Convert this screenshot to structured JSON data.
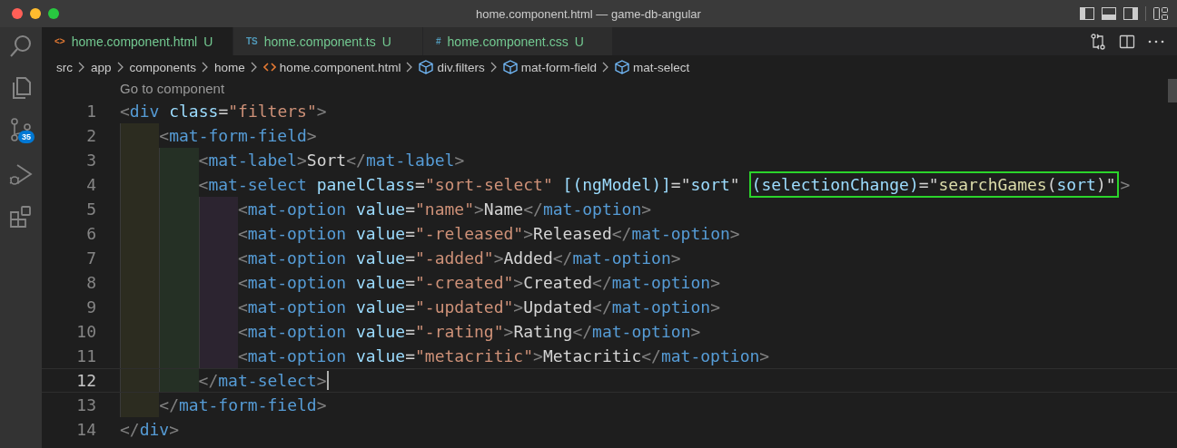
{
  "window": {
    "title": "home.component.html — game-db-angular"
  },
  "activity_bar": [
    {
      "kind": "search",
      "selected": false
    },
    {
      "kind": "files",
      "selected": false
    },
    {
      "kind": "source-control",
      "selected": false,
      "badge": "35"
    },
    {
      "kind": "debug",
      "selected": false
    },
    {
      "kind": "extensions",
      "selected": false
    }
  ],
  "tabs": [
    {
      "icon": "<>",
      "label": "home.component.html",
      "kind": "html",
      "status": "U",
      "selected": true
    },
    {
      "icon": "TS",
      "label": "home.component.ts",
      "kind": "ts",
      "status": "U",
      "selected": false
    },
    {
      "icon": "#",
      "label": "home.component.css",
      "kind": "css",
      "status": "U",
      "selected": false
    }
  ],
  "breadcrumbs": [
    {
      "label": "src",
      "kind": "folder"
    },
    {
      "label": "app",
      "kind": "folder"
    },
    {
      "label": "components",
      "kind": "folder"
    },
    {
      "label": "home",
      "kind": "folder"
    },
    {
      "label": "home.component.html",
      "kind": "html"
    },
    {
      "label": "div.filters",
      "kind": "element"
    },
    {
      "label": "mat-form-field",
      "kind": "element"
    },
    {
      "label": "mat-select",
      "kind": "element"
    }
  ],
  "code_lens": "Go to component",
  "lines": [
    {
      "number": "1",
      "current": false,
      "tokens": [
        {
          "text": "<",
          "kind": "p"
        },
        {
          "text": "div",
          "kind": "tag"
        },
        {
          "text": " class",
          "kind": "attr"
        },
        {
          "text": "=",
          "kind": "plain"
        },
        {
          "text": "\"filters\"",
          "kind": "str"
        },
        {
          "text": ">",
          "kind": "p"
        }
      ],
      "children": [
        {
          "number": "2",
          "current": false,
          "tokens": [
            {
              "text": "<",
              "kind": "p"
            },
            {
              "text": "mat-form-field",
              "kind": "tag"
            },
            {
              "text": ">",
              "kind": "p"
            }
          ],
          "children": [
            {
              "number": "3",
              "current": false,
              "tokens": [
                {
                  "text": "<",
                  "kind": "p"
                },
                {
                  "text": "mat-label",
                  "kind": "tag"
                },
                {
                  "text": ">",
                  "kind": "p"
                },
                {
                  "text": "Sort",
                  "kind": "plain"
                },
                {
                  "text": "</",
                  "kind": "p"
                },
                {
                  "text": "mat-label",
                  "kind": "tag"
                },
                {
                  "text": ">",
                  "kind": "p"
                }
              ]
            },
            {
              "number": "4",
              "current": false,
              "tokens": [
                {
                  "text": "<",
                  "kind": "p"
                },
                {
                  "text": "mat-select",
                  "kind": "tag"
                },
                {
                  "text": " panelClass",
                  "kind": "attr"
                },
                {
                  "text": "=",
                  "kind": "plain"
                },
                {
                  "text": "\"sort-select\"",
                  "kind": "str"
                },
                {
                  "text": " [(ngModel)]",
                  "kind": "attr"
                },
                {
                  "text": "=",
                  "kind": "plain"
                },
                {
                  "text": "\"",
                  "kind": "plain"
                },
                {
                  "text": "sort",
                  "kind": "attr"
                },
                {
                  "text": "\" ",
                  "kind": "plain"
                }
              ],
              "highlight_tokens": [
                {
                  "text": "(selectionChange)",
                  "kind": "attr"
                },
                {
                  "text": "=",
                  "kind": "plain"
                },
                {
                  "text": "\"",
                  "kind": "plain"
                },
                {
                  "text": "searchGames",
                  "kind": "fn"
                },
                {
                  "text": "(",
                  "kind": "plain"
                },
                {
                  "text": "sort",
                  "kind": "attr"
                },
                {
                  "text": ")\"",
                  "kind": "plain"
                }
              ],
              "tail_tokens": [
                {
                  "text": ">",
                  "kind": "p"
                }
              ],
              "children": [
                {
                  "number": "5",
                  "current": false,
                  "tokens": [
                    {
                      "text": "<",
                      "kind": "p"
                    },
                    {
                      "text": "mat-option",
                      "kind": "tag"
                    },
                    {
                      "text": " value",
                      "kind": "attr"
                    },
                    {
                      "text": "=",
                      "kind": "plain"
                    },
                    {
                      "text": "\"name\"",
                      "kind": "str"
                    },
                    {
                      "text": ">",
                      "kind": "p"
                    },
                    {
                      "text": "Name",
                      "kind": "plain"
                    },
                    {
                      "text": "</",
                      "kind": "p"
                    },
                    {
                      "text": "mat-option",
                      "kind": "tag"
                    },
                    {
                      "text": ">",
                      "kind": "p"
                    }
                  ]
                },
                {
                  "number": "6",
                  "current": false,
                  "tokens": [
                    {
                      "text": "<",
                      "kind": "p"
                    },
                    {
                      "text": "mat-option",
                      "kind": "tag"
                    },
                    {
                      "text": " value",
                      "kind": "attr"
                    },
                    {
                      "text": "=",
                      "kind": "plain"
                    },
                    {
                      "text": "\"-released\"",
                      "kind": "str"
                    },
                    {
                      "text": ">",
                      "kind": "p"
                    },
                    {
                      "text": "Released",
                      "kind": "plain"
                    },
                    {
                      "text": "</",
                      "kind": "p"
                    },
                    {
                      "text": "mat-option",
                      "kind": "tag"
                    },
                    {
                      "text": ">",
                      "kind": "p"
                    }
                  ]
                },
                {
                  "number": "7",
                  "current": false,
                  "tokens": [
                    {
                      "text": "<",
                      "kind": "p"
                    },
                    {
                      "text": "mat-option",
                      "kind": "tag"
                    },
                    {
                      "text": " value",
                      "kind": "attr"
                    },
                    {
                      "text": "=",
                      "kind": "plain"
                    },
                    {
                      "text": "\"-added\"",
                      "kind": "str"
                    },
                    {
                      "text": ">",
                      "kind": "p"
                    },
                    {
                      "text": "Added",
                      "kind": "plain"
                    },
                    {
                      "text": "</",
                      "kind": "p"
                    },
                    {
                      "text": "mat-option",
                      "kind": "tag"
                    },
                    {
                      "text": ">",
                      "kind": "p"
                    }
                  ]
                },
                {
                  "number": "8",
                  "current": false,
                  "tokens": [
                    {
                      "text": "<",
                      "kind": "p"
                    },
                    {
                      "text": "mat-option",
                      "kind": "tag"
                    },
                    {
                      "text": " value",
                      "kind": "attr"
                    },
                    {
                      "text": "=",
                      "kind": "plain"
                    },
                    {
                      "text": "\"-created\"",
                      "kind": "str"
                    },
                    {
                      "text": ">",
                      "kind": "p"
                    },
                    {
                      "text": "Created",
                      "kind": "plain"
                    },
                    {
                      "text": "</",
                      "kind": "p"
                    },
                    {
                      "text": "mat-option",
                      "kind": "tag"
                    },
                    {
                      "text": ">",
                      "kind": "p"
                    }
                  ]
                },
                {
                  "number": "9",
                  "current": false,
                  "tokens": [
                    {
                      "text": "<",
                      "kind": "p"
                    },
                    {
                      "text": "mat-option",
                      "kind": "tag"
                    },
                    {
                      "text": " value",
                      "kind": "attr"
                    },
                    {
                      "text": "=",
                      "kind": "plain"
                    },
                    {
                      "text": "\"-updated\"",
                      "kind": "str"
                    },
                    {
                      "text": ">",
                      "kind": "p"
                    },
                    {
                      "text": "Updated",
                      "kind": "plain"
                    },
                    {
                      "text": "</",
                      "kind": "p"
                    },
                    {
                      "text": "mat-option",
                      "kind": "tag"
                    },
                    {
                      "text": ">",
                      "kind": "p"
                    }
                  ]
                },
                {
                  "number": "10",
                  "current": false,
                  "tokens": [
                    {
                      "text": "<",
                      "kind": "p"
                    },
                    {
                      "text": "mat-option",
                      "kind": "tag"
                    },
                    {
                      "text": " value",
                      "kind": "attr"
                    },
                    {
                      "text": "=",
                      "kind": "plain"
                    },
                    {
                      "text": "\"-rating\"",
                      "kind": "str"
                    },
                    {
                      "text": ">",
                      "kind": "p"
                    },
                    {
                      "text": "Rating",
                      "kind": "plain"
                    },
                    {
                      "text": "</",
                      "kind": "p"
                    },
                    {
                      "text": "mat-option",
                      "kind": "tag"
                    },
                    {
                      "text": ">",
                      "kind": "p"
                    }
                  ]
                },
                {
                  "number": "11",
                  "current": false,
                  "tokens": [
                    {
                      "text": "<",
                      "kind": "p"
                    },
                    {
                      "text": "mat-option",
                      "kind": "tag"
                    },
                    {
                      "text": " value",
                      "kind": "attr"
                    },
                    {
                      "text": "=",
                      "kind": "plain"
                    },
                    {
                      "text": "\"metacritic\"",
                      "kind": "str"
                    },
                    {
                      "text": ">",
                      "kind": "p"
                    },
                    {
                      "text": "Metacritic",
                      "kind": "plain"
                    },
                    {
                      "text": "</",
                      "kind": "p"
                    },
                    {
                      "text": "mat-option",
                      "kind": "tag"
                    },
                    {
                      "text": ">",
                      "kind": "p"
                    }
                  ]
                }
              ]
            },
            {
              "number": "12",
              "current": true,
              "tokens": [
                {
                  "text": "</",
                  "kind": "p"
                },
                {
                  "text": "mat-select",
                  "kind": "tag"
                },
                {
                  "text": ">",
                  "kind": "p"
                }
              ]
            }
          ]
        },
        {
          "number": "13",
          "current": false,
          "tokens": [
            {
              "text": "</",
              "kind": "p"
            },
            {
              "text": "mat-form-field",
              "kind": "tag"
            },
            {
              "text": ">",
              "kind": "p"
            }
          ]
        }
      ]
    },
    {
      "number": "14",
      "current": false,
      "tokens": [
        {
          "text": "</",
          "kind": "p"
        },
        {
          "text": "div",
          "kind": "tag"
        },
        {
          "text": ">",
          "kind": "p"
        }
      ]
    }
  ]
}
